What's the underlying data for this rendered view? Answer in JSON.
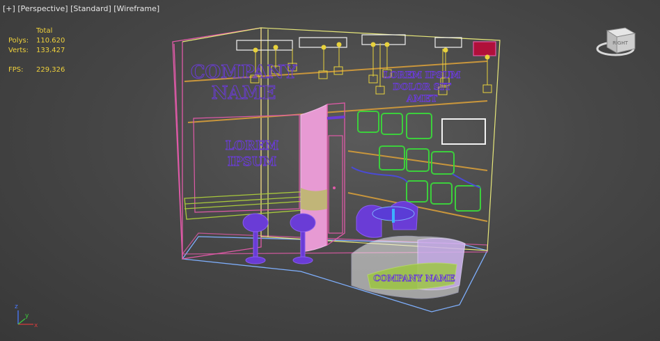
{
  "viewport": {
    "labels": {
      "plus": "[+]",
      "view": "[Perspective]",
      "shading_mode": "[Standard]",
      "display": "[Wireframe]"
    },
    "stats": {
      "header": "Total",
      "polys_label": "Polys:",
      "polys_value": "110.620",
      "verts_label": "Verts:",
      "verts_value": "133.427",
      "fps_label": "FPS:",
      "fps_value": "229,326"
    },
    "viewcube_label": "RIGHT"
  },
  "scene": {
    "left_wall_text": [
      "COMPANY",
      "NAME"
    ],
    "panel_text": [
      "LOREM",
      "IPSUM"
    ],
    "right_wall_text": [
      "LOREM IPSUM",
      "DOLOR SIT",
      "AMET"
    ],
    "counter_text": "COMPANY NAME"
  },
  "colors": {
    "wire_yellow": "#e8e87a",
    "wire_pink": "#e05aa8",
    "wire_green": "#3ccf3c",
    "wire_purple": "#6a3cd6",
    "wire_orange": "#c9963c",
    "stats_yellow": "#f0d23c"
  }
}
